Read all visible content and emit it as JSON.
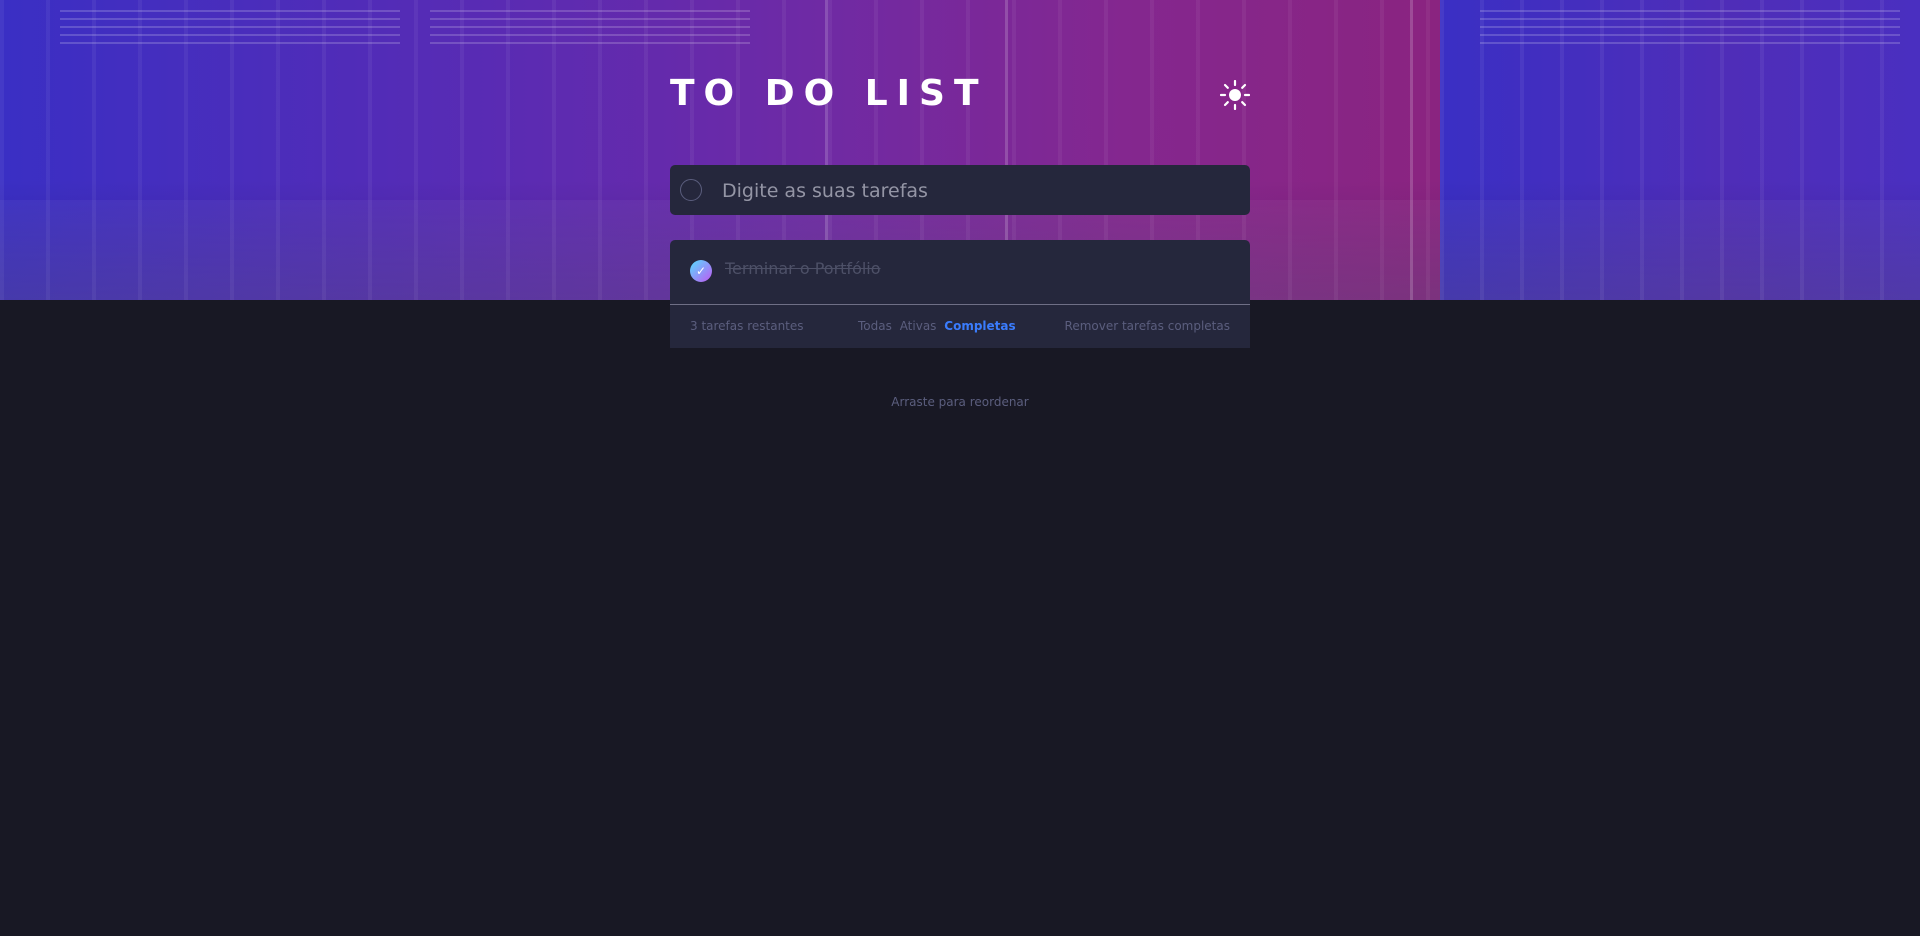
{
  "app": {
    "title": "TO DO LIST"
  },
  "header": {
    "theme_icon": "sun-icon"
  },
  "new_task": {
    "placeholder": "Digite as suas tarefas",
    "value": ""
  },
  "tasks": [
    {
      "text": "Terminar o Portfólio",
      "completed": true
    }
  ],
  "footer": {
    "remaining": "3 tarefas restantes",
    "filters": {
      "all": "Todas",
      "active": "Ativas",
      "completed": "Completas",
      "selected": "completed"
    },
    "clear_completed": "Remover tarefas completas"
  },
  "hint": "Arraste para reordenar",
  "colors": {
    "background": "#181824",
    "card": "#25273c",
    "accent": "#3a7cfd",
    "check_gradient_start": "#55ddff",
    "check_gradient_end": "#c058f3"
  }
}
